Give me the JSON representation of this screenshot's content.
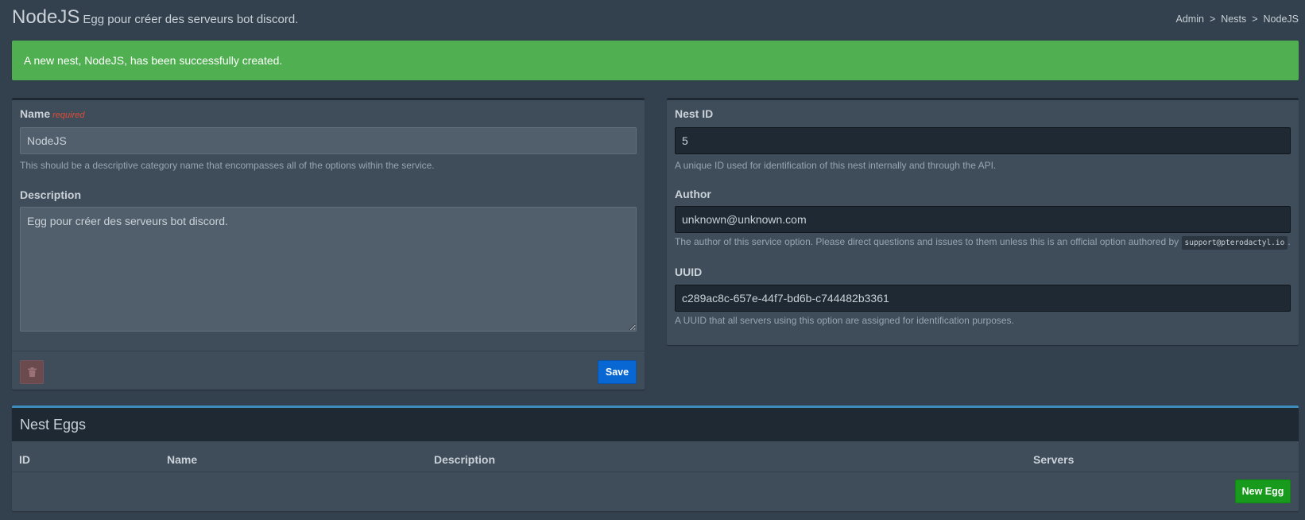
{
  "header": {
    "title": "NodeJS",
    "subtitle": "Egg pour créer des serveurs bot discord.",
    "breadcrumb": [
      "Admin",
      "Nests",
      "NodeJS"
    ],
    "breadcrumb_sep": ">"
  },
  "alert": {
    "message": "A new nest, NodeJS, has been successfully created."
  },
  "nest_form": {
    "name_label": "Name",
    "required_tag": "required",
    "name_value": "NodeJS",
    "name_help": "This should be a descriptive category name that encompasses all of the options within the service.",
    "description_label": "Description",
    "description_value": "Egg pour créer des serveurs bot discord.",
    "delete_icon": "trash-icon",
    "save_label": "Save"
  },
  "nest_info": {
    "id_label": "Nest ID",
    "id_value": "5",
    "id_help": "A unique ID used for identification of this nest internally and through the API.",
    "author_label": "Author",
    "author_value": "unknown@unknown.com",
    "author_help_prefix": "The author of this service option. Please direct questions and issues to them unless this is an official option authored by",
    "author_help_code": "support@pterodactyl.io",
    "author_help_suffix": ".",
    "uuid_label": "UUID",
    "uuid_value": "c289ac8c-657e-44f7-bd6b-c744482b3361",
    "uuid_help": "A UUID that all servers using this option are assigned for identification purposes."
  },
  "nest_eggs": {
    "title": "Nest Eggs",
    "columns": [
      "ID",
      "Name",
      "Description",
      "Servers"
    ],
    "new_egg_label": "New Egg"
  },
  "colors": {
    "background": "#33404d",
    "box": "#3f4d5a",
    "success": "#50af51",
    "primary": "#0967d3",
    "new_egg": "#189a1c",
    "accent_top": "#3c8dbc"
  }
}
